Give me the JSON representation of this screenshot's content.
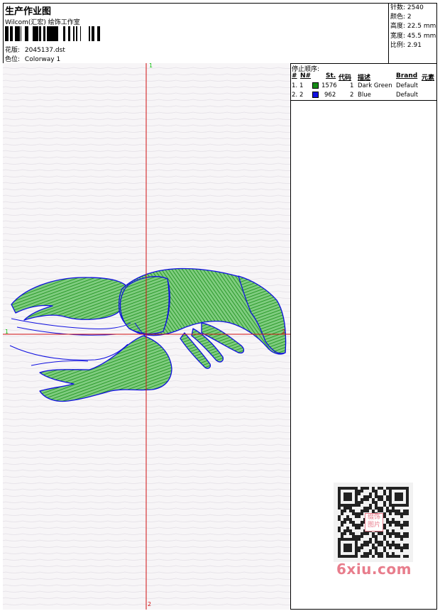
{
  "header": {
    "title": "生产作业图",
    "company": "Wilcom(汇宏) 绘饰工作室",
    "design_label": "花版:",
    "design_value": "2045137.dst",
    "colorway_label": "色位:",
    "colorway_value": "Colorway 1"
  },
  "stats": [
    {
      "label": "针数:",
      "value": "2540"
    },
    {
      "label": "颜色:",
      "value": "2"
    },
    {
      "label": "高度:",
      "value": "22.5 mm"
    },
    {
      "label": "宽度:",
      "value": "45.5 mm"
    },
    {
      "label": "比例:",
      "value": "2.91"
    }
  ],
  "stop_sequence": {
    "title": "停止顺序:",
    "columns": [
      "#",
      "N#",
      "St.",
      "代码",
      "描述",
      "Brand",
      "元素"
    ],
    "rows": [
      {
        "num": "1.",
        "n": "1",
        "color": "#158c15",
        "stitches": "1576",
        "code": "1",
        "description": "Dark Green",
        "brand": "Default"
      },
      {
        "num": "2.",
        "n": "2",
        "color": "#1010e0",
        "stitches": "962",
        "code": "2",
        "description": "Blue",
        "brand": "Default"
      }
    ]
  },
  "canvas": {
    "axis_top_label": "1",
    "axis_bottom_label": "2",
    "axis_left_label": "1",
    "axis_right_label": "2",
    "axis_color": "#d01010",
    "label_color_green": "#10c010",
    "label_color_red": "#d01010"
  },
  "watermark": {
    "text": "6xiu.com",
    "qr_badge": "缀饰图片"
  },
  "icons": {
    "barcode": "barcode-icon",
    "qr": "qr-code-icon",
    "design": "lobster-embroidery-icon"
  }
}
